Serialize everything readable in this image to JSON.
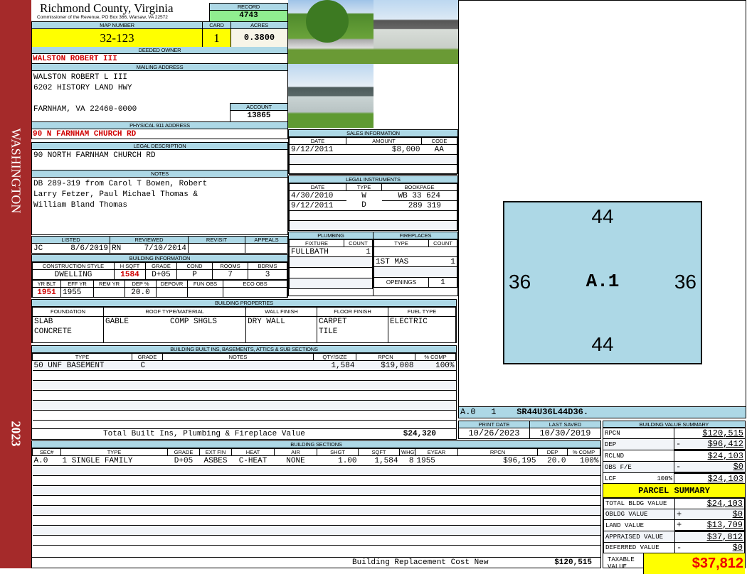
{
  "sidebar": {
    "district": "WASHINGTON",
    "year": "2023"
  },
  "header": {
    "county": "Richmond County, Virginia",
    "subtitle": "Commissioner of the Revenue, PO Box 366, Warsaw, VA 22572",
    "record_label": "RECORD",
    "record": "4743",
    "map_label": "MAP NUMBER",
    "map_number": "32-123",
    "card_label": "CARD",
    "card": "1",
    "acres_label": "ACRES",
    "acres": "0.3800"
  },
  "owner": {
    "label": "DEEDED OWNER",
    "name": "WALSTON ROBERT III",
    "mailing_label": "MAILING ADDRESS",
    "mailing": [
      "WALSTON ROBERT L III",
      "6202 HISTORY LAND HWY",
      "",
      "FARNHAM, VA 22460-0000"
    ],
    "account_label": "ACCOUNT",
    "account": "13865",
    "physical_label": "PHYSICAL 911 ADDRESS",
    "physical": "90 N FARNHAM CHURCH RD"
  },
  "legal": {
    "label": "LEGAL DESCRIPTION",
    "text": "90 NORTH FARNHAM CHURCH RD"
  },
  "notes": {
    "label": "NOTES",
    "lines": [
      "DB 289-319 from Carol T Bowen, Robert",
      "Larry Fetzer, Paul Michael Thomas &",
      "William Bland Thomas"
    ]
  },
  "sales": {
    "label": "SALES INFORMATION",
    "cols": [
      "DATE",
      "AMOUNT",
      "CODE"
    ],
    "rows": [
      [
        "9/12/2011",
        "$8,000",
        "AA"
      ]
    ]
  },
  "instruments": {
    "label": "LEGAL INSTRUMENTS",
    "cols": [
      "DATE",
      "TYPE",
      "BOOKPAGE"
    ],
    "rows": [
      [
        "4/30/2010",
        "W",
        "WB 33 624"
      ],
      [
        "9/12/2011",
        "D",
        "289 319"
      ]
    ]
  },
  "listing": {
    "cols": [
      "LISTED",
      "REVIEWED",
      "REVISIT",
      "APPEALS"
    ],
    "listed_by": "JC",
    "listed": "8/6/2019",
    "reviewed_by": "RN",
    "reviewed": "7/10/2014",
    "revisit": "",
    "appeals": ""
  },
  "building_info": {
    "label": "BUILDING INFORMATION",
    "cols1": [
      "CONSTRUCTION STYLE",
      "H SQFT",
      "GRADE",
      "COND",
      "ROOMS",
      "BDRMS"
    ],
    "vals1": [
      "DWELLING",
      "1584",
      "D+05",
      "P",
      "7",
      "3"
    ],
    "cols2": [
      "YR BLT",
      "EFF YR",
      "REM YR",
      "DEP %",
      "DEPOVR",
      "FUN OBS",
      "ECO OBS"
    ],
    "vals2": [
      "1951",
      "1955",
      "",
      "20.0",
      "",
      "",
      ""
    ]
  },
  "plumbing": {
    "label": "PLUMBING",
    "cols": [
      "FIXTURE",
      "COUNT"
    ],
    "rows": [
      [
        "FULLBATH",
        "1"
      ]
    ]
  },
  "fireplaces": {
    "label": "FIREPLACES",
    "cols": [
      "TYPE",
      "COUNT"
    ],
    "rows": [
      [
        "",
        ""
      ],
      [
        "1ST MAS",
        "1"
      ]
    ],
    "openings_label": "OPENINGS",
    "openings": "1"
  },
  "properties": {
    "label": "BUILDING PROPERTIES",
    "cols": [
      "FOUNDATION",
      "ROOF TYPE/MATERIAL",
      "WALL FINISH",
      "FLOOR FINISH",
      "FUEL TYPE"
    ],
    "foundation": [
      "SLAB",
      "CONCRETE"
    ],
    "roof_type": "GABLE",
    "roof_material": "COMP SHGLS",
    "wall": [
      "DRY WALL"
    ],
    "floor": [
      "CARPET",
      "TILE"
    ],
    "fuel": [
      "ELECTRIC"
    ]
  },
  "builtins": {
    "label": "BUILDING BUILT INS, BASEMENTS, ATTICS & SUB SECTIONS",
    "cols": [
      "TYPE",
      "GRADE",
      "NOTES",
      "QTY/SIZE",
      "RPCN",
      "% COMP"
    ],
    "rows": [
      [
        "50 UNF BASEMENT",
        "C",
        "",
        "1,584",
        "$19,008",
        "100%"
      ]
    ],
    "total_label": "Total Built Ins, Plumbing & Fireplace Value",
    "total": "$24,320"
  },
  "sketch": {
    "top": "44",
    "bottom": "44",
    "left": "36",
    "right": "36",
    "label": "A.1",
    "sec": "A.0",
    "num": "1",
    "vector": "SR44U36L44D36."
  },
  "dates": {
    "print_label": "PRINT DATE",
    "print": "10/26/2023",
    "saved_label": "LAST SAVED",
    "saved": "10/30/2019"
  },
  "sections": {
    "label": "BUILDING SECTIONS",
    "cols": [
      "SEC#",
      "TYPE",
      "GRADE",
      "EXT FIN",
      "HEAT",
      "AIR",
      "SHGT",
      "SQFT",
      "WHGT",
      "EYEAR",
      "RPCN",
      "DEP",
      "% COMP"
    ],
    "rows": [
      [
        "A.0",
        "1 SINGLE FAMILY",
        "D+05",
        "ASBES",
        "C-HEAT",
        "NONE",
        "1.00",
        "1,584",
        "8",
        "1955",
        "$96,195",
        "20.0",
        "100%"
      ]
    ],
    "total_label": "Building Replacement Cost New",
    "total": "$120,515"
  },
  "value_summary": {
    "label": "BUILDING VALUE SUMMARY",
    "rows": [
      {
        "k": "RPCN",
        "s": "",
        "v": "$120,515"
      },
      {
        "k": "DEP",
        "s": "-",
        "v": "$96,412"
      },
      {
        "k": "RCLND",
        "s": "",
        "v": "$24,103"
      },
      {
        "k": "OBS F/E",
        "s": "-",
        "v": "$0"
      },
      {
        "k": "LCF",
        "p": "100%",
        "s": "",
        "v": "$24,103"
      }
    ]
  },
  "parcel": {
    "label": "PARCEL SUMMARY",
    "rows": [
      {
        "k": "TOTAL BLDG VALUE",
        "s": "",
        "v": "$24,103"
      },
      {
        "k": "OBLDG VALUE",
        "s": "+",
        "v": "$0"
      },
      {
        "k": "LAND VALUE",
        "s": "+",
        "v": "$13,709"
      },
      {
        "k": "APPRAISED VALUE",
        "s": "",
        "v": "$37,812"
      },
      {
        "k": "DEFERRED VALUE",
        "s": "-",
        "v": "$0"
      }
    ],
    "taxable_label": "TAXABLE VALUE",
    "taxable": "$37,812"
  },
  "colors": {
    "sidebar": "#a52a2a",
    "header": "#add8e6",
    "highlight": "#ffff00",
    "record": "#90ee90",
    "alert": "#d00000"
  }
}
